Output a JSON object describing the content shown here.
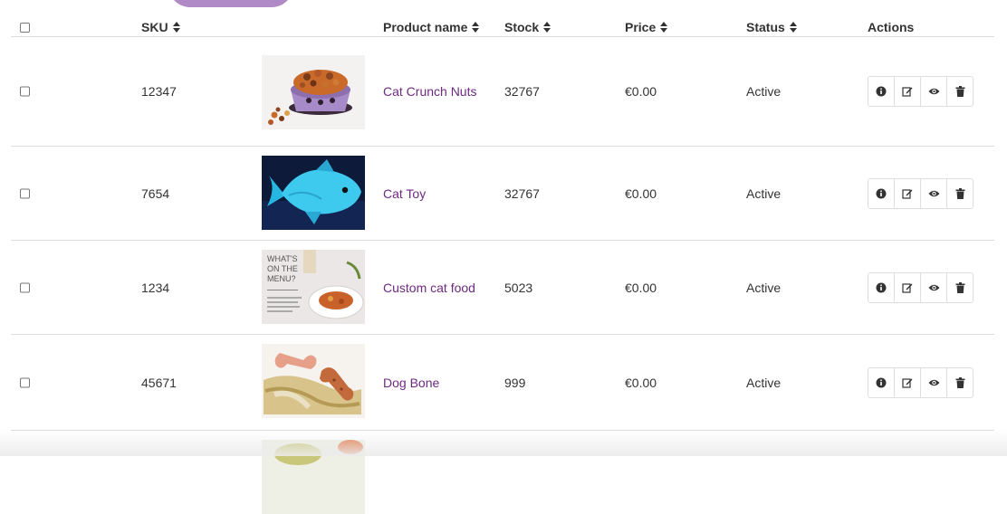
{
  "table": {
    "headers": {
      "sku": "SKU",
      "product_name": "Product name",
      "stock": "Stock",
      "price": "Price",
      "status": "Status",
      "actions": "Actions"
    },
    "rows": [
      {
        "sku": "12347",
        "name": "Cat Crunch Nuts",
        "stock": "32767",
        "price": "€0.00",
        "status": "Active"
      },
      {
        "sku": "7654",
        "name": "Cat Toy",
        "stock": "32767",
        "price": "€0.00",
        "status": "Active"
      },
      {
        "sku": "1234",
        "name": "Custom cat food",
        "stock": "5023",
        "price": "€0.00",
        "status": "Active"
      },
      {
        "sku": "45671",
        "name": "Dog Bone",
        "stock": "999",
        "price": "€0.00",
        "status": "Active"
      }
    ],
    "thumb_texts": {
      "menu_heading": "WHAT'S ON THE MENU?"
    }
  },
  "icons": [
    "info-icon",
    "edit-icon",
    "view-icon",
    "delete-icon"
  ],
  "colors": {
    "accent": "#6e2a80",
    "pill": "#b089c7",
    "border": "#dcdcdc"
  }
}
